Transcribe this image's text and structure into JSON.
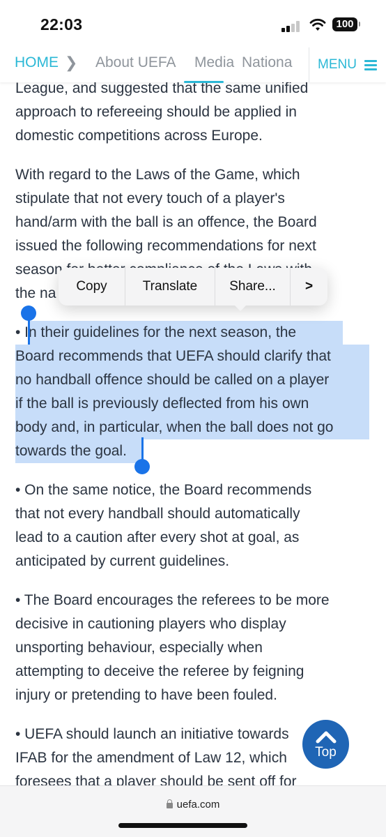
{
  "status_bar": {
    "time": "22:03",
    "battery": "100"
  },
  "nav": {
    "home": "HOME",
    "items": [
      "About UEFA",
      "Media",
      "Nationa"
    ],
    "active_item": "Media",
    "menu_label": "MENU"
  },
  "article": {
    "paragraphs": [
      {
        "lines": [
          "League, and suggested that the same unified",
          "approach to refereeing should be applied in",
          "domestic competitions across Europe."
        ]
      },
      {
        "lines": [
          "With regard to the Laws of the Game, which",
          "stipulate that not every touch of a player's",
          "hand/arm with the ball is an offence, the Board",
          "issued the following recommendations for next",
          "season for better compliance of the Laws with",
          "the na"
        ]
      },
      {
        "lines": [
          "• In their guidelines for the next season, the",
          "Board recommends that UEFA should clarify that",
          "no handball offence should be called on a player",
          "if the ball is previously deflected from his own",
          "body and, in particular, when the ball does not go",
          "towards the goal."
        ],
        "selected": true
      },
      {
        "lines": [
          "• On the same notice, the Board recommends",
          "that not every handball should automatically",
          "lead to a caution after every shot at goal, as",
          "anticipated by current guidelines."
        ]
      },
      {
        "lines": [
          "• The Board encourages the referees to be more",
          "decisive in cautioning players who display",
          "unsporting behaviour, especially when",
          "attempting to deceive the referee by feigning",
          "injury or pretending to have been fouled."
        ]
      },
      {
        "lines": [
          "• UEFA should launch an initiative towards",
          "IFAB for the amendment of Law 12, which",
          "foresees that a player should be sent off for"
        ]
      }
    ]
  },
  "context_menu": {
    "items": [
      "Copy",
      "Translate",
      "Share...",
      ">"
    ]
  },
  "top_button": {
    "label": "Top"
  },
  "browser": {
    "url": "uefa.com"
  },
  "colors": {
    "accent": "#2bb8d6",
    "selection": "#c7ddf9",
    "handle": "#1a73e8",
    "top_button": "#1f65b5"
  }
}
